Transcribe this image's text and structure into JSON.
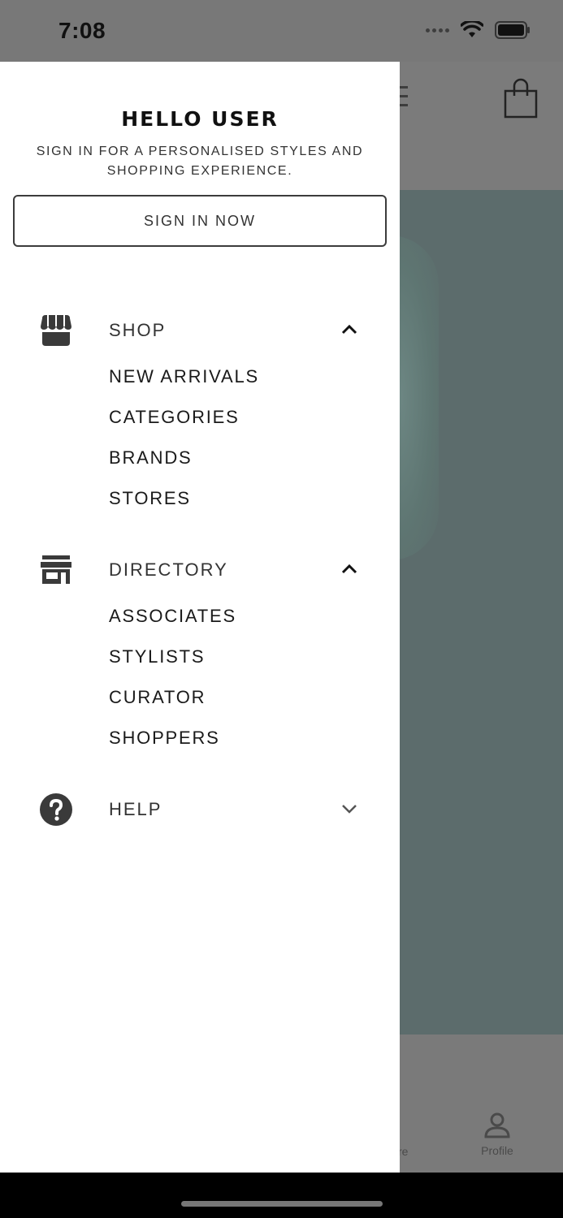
{
  "status_bar": {
    "time": "7:08"
  },
  "background": {
    "tab_profile_label": "Profile",
    "tab_store_label_partial": "re"
  },
  "drawer": {
    "greeting": "HELLO USER",
    "subtitle": "SIGN IN FOR A PERSONALISED STYLES AND SHOPPING EXPERIENCE.",
    "sign_in_button": "SIGN IN NOW",
    "sections": [
      {
        "label": "SHOP",
        "icon": "storefront-icon",
        "expanded": true,
        "items": [
          "NEW ARRIVALS",
          "CATEGORIES",
          "BRANDS",
          "STORES"
        ]
      },
      {
        "label": "DIRECTORY",
        "icon": "store-icon",
        "expanded": true,
        "items": [
          "ASSOCIATES",
          "STYLISTS",
          "CURATOR",
          "SHOPPERS"
        ]
      },
      {
        "label": "HELP",
        "icon": "question-circle-icon",
        "expanded": false,
        "items": []
      }
    ]
  },
  "colors": {
    "overlay": "#7a7a7a",
    "hero": "#5c6c6c",
    "text_dark": "#333333",
    "drawer_bg": "#ffffff"
  }
}
